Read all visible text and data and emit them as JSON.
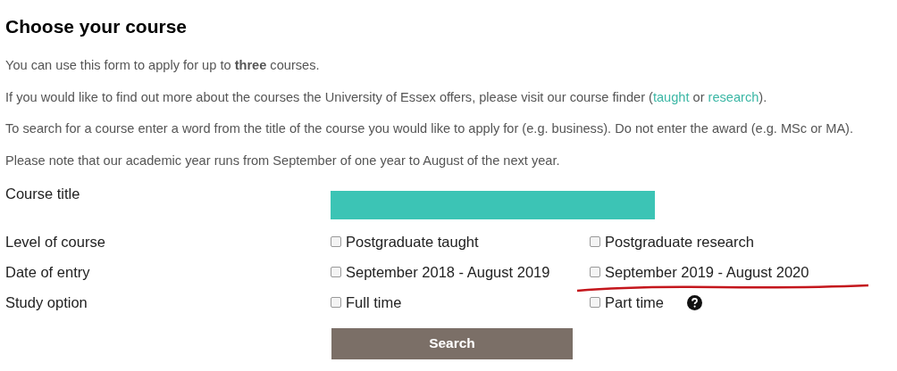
{
  "heading": "Choose your course",
  "intro": [
    {
      "parts": [
        {
          "kind": "text",
          "text": "You can use this form to apply for up to **three** courses."
        }
      ]
    },
    {
      "parts": [
        {
          "kind": "text",
          "text": "If you would like to find out more about the courses the University of Essex offers, please visit our course finder ("
        },
        {
          "kind": "link",
          "text": "taught"
        },
        {
          "kind": "text",
          "text": " or "
        },
        {
          "kind": "link",
          "text": "research"
        },
        {
          "kind": "text",
          "text": ")."
        }
      ]
    },
    {
      "parts": [
        {
          "kind": "text",
          "text": "To search for a course enter a word from the title of the course you would like to apply for (e.g. business). Do not enter the award (e.g. MSc or MA)."
        }
      ]
    },
    {
      "parts": [
        {
          "kind": "text",
          "text": "Please note that our academic year runs from September of one year to August of the next year."
        }
      ]
    }
  ],
  "form": [
    {
      "kind": "input",
      "label": "Course title"
    },
    {
      "kind": "checks",
      "label": "Level of course",
      "options": [
        {
          "label": "Postgraduate taught",
          "checked": false
        },
        {
          "label": "Postgraduate research",
          "checked": false
        }
      ]
    },
    {
      "kind": "checks",
      "label": "Date of entry",
      "options": [
        {
          "label": "September 2018 - August 2019",
          "checked": false
        },
        {
          "label": "September 2019 - August 2020",
          "checked": false,
          "underlined": true
        }
      ]
    },
    {
      "kind": "checks",
      "label": "Study option",
      "help": true,
      "options": [
        {
          "label": "Full time",
          "checked": false
        },
        {
          "label": "Part time",
          "checked": false
        }
      ]
    }
  ],
  "search_button": "Search"
}
